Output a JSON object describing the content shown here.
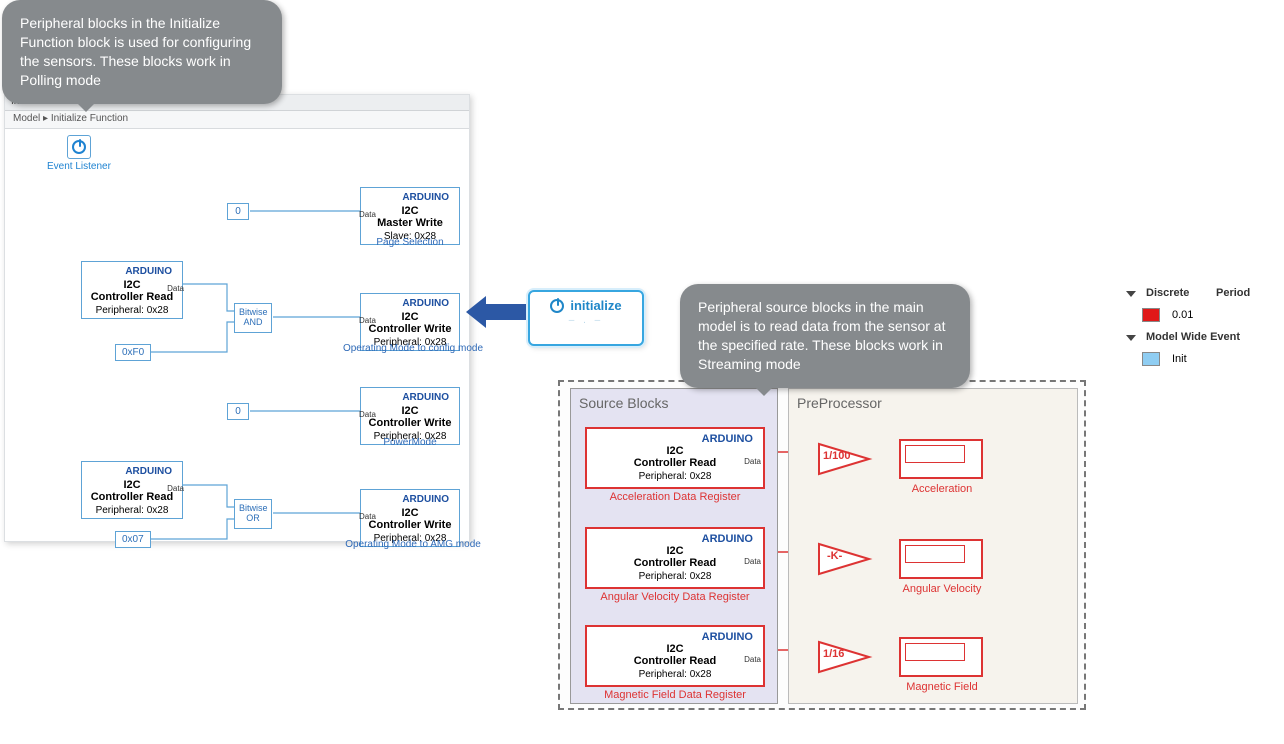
{
  "callouts": {
    "c1": "Peripheral blocks in the Initialize Function block  is used for configuring the sensors. These blocks work in Polling mode",
    "c2": "Peripheral source blocks in the main model is to read data from the sensor at the specified rate. These blocks work in Streaming mode"
  },
  "init_panel": {
    "tab": "Initialize Function",
    "breadcrumb_root": "Model",
    "breadcrumb_leaf": "Initialize Function",
    "event_listener": "Event Listener",
    "vendor": "ARDUINO",
    "const0": "0",
    "const_0xF0": "0xF0",
    "const_0x07": "0x07",
    "logic_and_1": "Bitwise",
    "logic_and_2": "AND",
    "logic_or_1": "Bitwise",
    "logic_or_2": "OR",
    "read": {
      "l1": "I2C",
      "l2": "Controller Read",
      "l3": "Peripheral: 0x28",
      "port_out": "Data"
    },
    "write": {
      "l1": "I2C",
      "l2": "Controller Write",
      "l3": "Peripheral: 0x28",
      "port_in": "Data"
    },
    "mwrite": {
      "l1": "I2C",
      "l2": "Master Write",
      "l3": "Slave: 0x28",
      "port_in": "Data"
    },
    "labels": {
      "page_sel": "Page Selection",
      "cfg": "Operating Mode to config mode",
      "pwr": "PowerMode",
      "amg": "Operating Mode to AMG mode"
    }
  },
  "init_block": {
    "label": "initialize",
    "dots": "– . –"
  },
  "main_model": {
    "source_title": "Source Blocks",
    "preproc_title": "PreProcessor",
    "vendor": "ARDUINO",
    "read": {
      "l1": "I2C",
      "l2": "Controller Read",
      "l3": "Peripheral: 0x28",
      "port_out": "Data"
    },
    "row1": {
      "label": "Acceleration Data Register",
      "gain": "1/100",
      "scope": "Acceleration"
    },
    "row2": {
      "label": "Angular Velocity Data Register",
      "gain": "-K-",
      "scope": "Angular Velocity"
    },
    "row3": {
      "label": "Magnetic Field Data Register",
      "gain": "1/16",
      "scope": "Magnetic Field"
    }
  },
  "legend": {
    "h1": "Discrete",
    "h2": "Period",
    "period": "0.01",
    "h3": "Model Wide Event",
    "evt": "Init",
    "color_discrete": "#e01919",
    "color_event": "#8fcdf2"
  }
}
